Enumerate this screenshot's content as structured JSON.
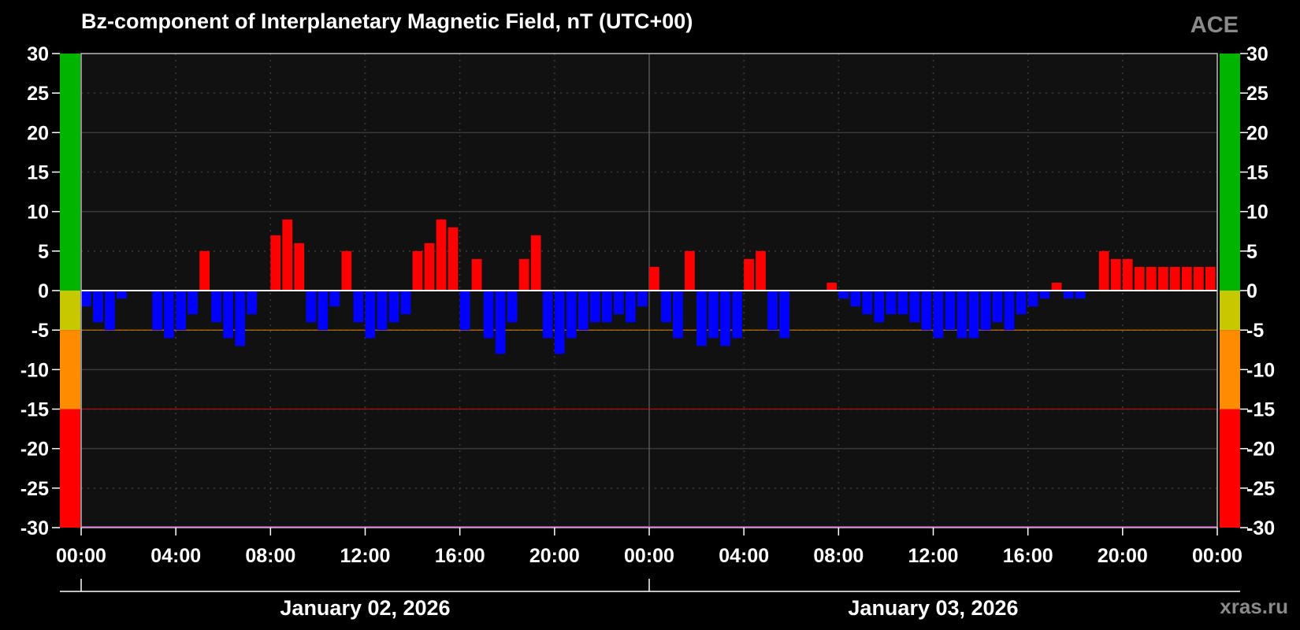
{
  "chart_data": {
    "type": "bar",
    "title": "Bz-component of Interplanetary Magnetic Field, nT (UTC+00)",
    "source_label": "ACE",
    "site_label": "xras.ru",
    "ylim": [
      -30,
      30
    ],
    "yticks": [
      30,
      25,
      20,
      15,
      10,
      5,
      0,
      -5,
      -10,
      -15,
      -20,
      -25,
      -30
    ],
    "xlim_hours": [
      0,
      48
    ],
    "xtick_labels": [
      "00:00",
      "04:00",
      "08:00",
      "12:00",
      "16:00",
      "20:00",
      "00:00",
      "04:00",
      "08:00",
      "12:00",
      "16:00",
      "20:00",
      "00:00"
    ],
    "dates": [
      "January 02, 2026",
      "January 03, 2026"
    ],
    "grid": true,
    "thresholds": [
      {
        "value": -5,
        "color": "#c87800"
      },
      {
        "value": -15,
        "color": "#b01010"
      }
    ],
    "zones": [
      {
        "from": 0,
        "to": 30,
        "color": "#00b400"
      },
      {
        "from": -5,
        "to": 0,
        "color": "#c8c800"
      },
      {
        "from": -15,
        "to": -5,
        "color": "#ff8c00"
      },
      {
        "from": -30,
        "to": -15,
        "color": "#ff0000"
      }
    ],
    "positive_color": "#ff0000",
    "negative_color": "#0000ff",
    "series": [
      {
        "x_hours": [
          0.0,
          0.5,
          1.0,
          1.5,
          2.0,
          2.5,
          3.0,
          3.5,
          4.0,
          4.5,
          5.0,
          5.5,
          6.0,
          6.5,
          7.0,
          7.5,
          8.0,
          8.5,
          9.0,
          9.5,
          10.0,
          10.5,
          11.0,
          11.5,
          12.0,
          12.5,
          13.0,
          13.5,
          14.0,
          14.5,
          15.0,
          15.5,
          16.0,
          16.5,
          17.0,
          17.5,
          18.0,
          18.5,
          19.0,
          19.5,
          20.0,
          20.5,
          21.0,
          21.5,
          22.0,
          22.5,
          23.0,
          23.5,
          24.0,
          24.5,
          25.0,
          25.5,
          26.0,
          26.5,
          27.0,
          27.5,
          28.0,
          28.5,
          29.0,
          29.5,
          30.0,
          30.5,
          31.0,
          31.5,
          32.0,
          32.5,
          33.0,
          33.5,
          34.0,
          34.5,
          35.0,
          35.5,
          36.0,
          36.5,
          37.0,
          37.5,
          38.0,
          38.5,
          39.0,
          39.5,
          40.0,
          40.5,
          41.0,
          41.5,
          42.0,
          42.5,
          43.0,
          43.5,
          44.0,
          44.5,
          45.0,
          45.5,
          46.0,
          46.5,
          47.0,
          47.5
        ],
        "values": [
          -2,
          -4,
          -5,
          -1,
          0,
          0,
          -5,
          -6,
          -5,
          -3,
          5,
          -4,
          -6,
          -7,
          -3,
          0,
          7,
          9,
          6,
          -4,
          -5,
          -2,
          5,
          -4,
          -6,
          -5,
          -4,
          -3,
          5,
          6,
          9,
          8,
          -5,
          4,
          -6,
          -8,
          -4,
          4,
          7,
          -6,
          -8,
          -6,
          -5,
          -4,
          -4,
          -3,
          -4,
          -2,
          3,
          -4,
          -6,
          5,
          -7,
          -6,
          -7,
          -6,
          4,
          5,
          -5,
          -6,
          0,
          0,
          0,
          1,
          -1,
          -2,
          -3,
          -4,
          -3,
          -3,
          -4,
          -5,
          -6,
          -5,
          -6,
          -6,
          -5,
          -4,
          -5,
          -3,
          -2,
          -1,
          1,
          -1,
          -1,
          0,
          5,
          4,
          4,
          3,
          3,
          3,
          3,
          3,
          3,
          3
        ]
      }
    ]
  }
}
